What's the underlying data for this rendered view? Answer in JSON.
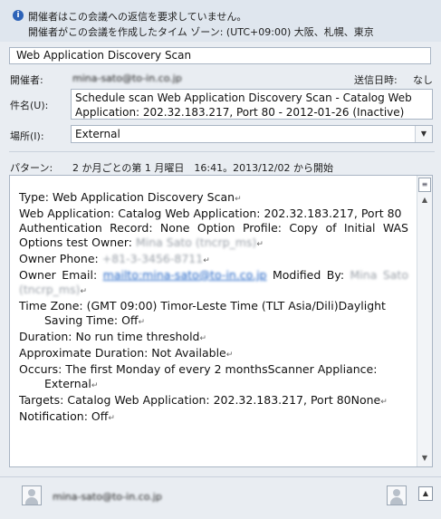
{
  "info_bar": {
    "line1": "開催者はこの会議への返信を要求していません。",
    "line2": "開催者がこの会議を作成したタイム ゾーン: (UTC+09:00) 大阪、札幌、東京"
  },
  "subject_banner": "Web Application Discovery Scan",
  "organizer": {
    "label": "開催者:",
    "value": "mina-sato@to-in.co.jp",
    "sent_label": "送信日時:",
    "sent_value": "なし"
  },
  "subject": {
    "label": "件名(U):",
    "value": "Schedule scan Web Application Discovery Scan - Catalog Web Application: 202.32.183.217, Port 80 - 2012-01-26 (Inactive)"
  },
  "location": {
    "label": "場所(I):",
    "value": "External"
  },
  "pattern": {
    "label": "パターン:",
    "value": "2 か月ごとの第 1 月曜日　16:41。2013/12/02 から開始"
  },
  "body": {
    "type": "Type: Web Application Discovery Scan",
    "webapp": "Web Application: Catalog Web Application: 202.32.183.217, Port 80",
    "auth": "Authentication Record: None Option Profile: Copy of Initial WAS Options test Owner:",
    "owner_name": "Mina Sato (tncrp_ms)",
    "owner_phone_label": "Owner Phone:",
    "owner_phone": "+81-3-3456-8711",
    "owner_email_label": "Owner Email:",
    "owner_email": "mailto:mina-sato@to-in.co.jp",
    "modified_by_label": "Modified By:",
    "modified_by": "Mina Sato (tncrp_ms)",
    "timezone": "Time Zone: (GMT 09:00) Timor-Leste Time (TLT Asia/Dili)Daylight",
    "timezone_cont": "Saving Time: Off",
    "duration": "Duration: No run time threshold",
    "approx": "Approximate Duration: Not Available",
    "occurs": "Occurs: The first Monday of every 2 monthsScanner Appliance:",
    "occurs_cont": "External",
    "targets": "Targets: Catalog Web Application: 202.32.183.217, Port 80None",
    "notification": "Notification: Off",
    "para_mark": "↵"
  },
  "footer": {
    "person": "mina-sato@to-in.co.jp"
  },
  "icons": {
    "info": "info-icon",
    "dropdown": "chevron-down-icon",
    "scroll_up": "chevron-up-icon",
    "scroll_down": "chevron-down-icon",
    "expand": "chevron-up-icon",
    "avatar": "person-icon"
  }
}
